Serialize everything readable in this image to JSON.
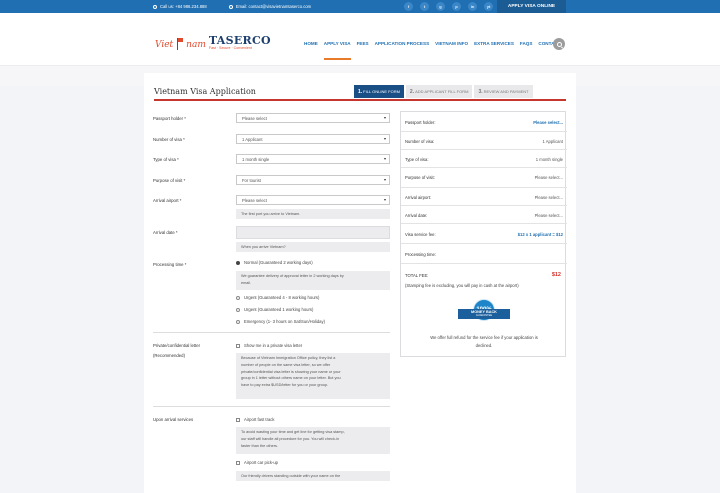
{
  "topbar": {
    "phone": "Call us: +84 986.234.888",
    "email": "Email: contact@visavietnamtaserco.com",
    "socials": [
      "f",
      "t",
      "g",
      "p",
      "in",
      "yt",
      "ig"
    ],
    "apply_label": "APPLY VISA ONLINE"
  },
  "logo": {
    "viet": "Viet",
    "nam": "nam",
    "brand": "TASERCO",
    "tagline": "Fast · Secure · Convenient"
  },
  "nav": [
    "HOME",
    "APPLY VISA",
    "FEES",
    "APPLICATION PROCESS",
    "VIETNAM INFO",
    "EXTRA SERVICES",
    "FAQS",
    "CONTACT"
  ],
  "form": {
    "title": "Vietnam Visa Application",
    "steps": [
      {
        "num": "1.",
        "label": "FILL ONLINE FORM"
      },
      {
        "num": "2.",
        "label": "ADD APPLICANT FILL FORM"
      },
      {
        "num": "3.",
        "label": "REVIEW AND PAYMENT"
      }
    ],
    "passport_holder": {
      "label": "Passport holder *",
      "value": "Please select"
    },
    "number_of_visa": {
      "label": "Number of visa *",
      "value": "1 Applicant"
    },
    "type_of_visa": {
      "label": "Type of visa *",
      "value": "1 month single"
    },
    "purpose_of_visit": {
      "label": "Purpose of visit *",
      "value": "For tourist"
    },
    "arrival_airport": {
      "label": "Arrival airport *",
      "value": "Please select",
      "hint": "The first port you arrive to Vietnam."
    },
    "arrival_date": {
      "label": "Arrival date *",
      "value": "",
      "hint": "When you arrive Vietnam?"
    },
    "processing_time": {
      "label": "Processing time *",
      "options": [
        "Normal (Guaranteed 2 working days)",
        "Urgent (Guaranteed 4 - 8 working hours)",
        "Urgent (Guaranteed 1 working hours)",
        "Emergency (1- 3 hours on Sat/Sun/Holiday)"
      ],
      "selected": 0,
      "note_l1": "We guarantee delivery of approval letter in 2 working days by",
      "note_l2": "email."
    },
    "private_letter": {
      "label": "Private/confidential letter",
      "sublabel": "(Recommended)",
      "option": "Show me in a private visa letter",
      "note": [
        "Because of Vietnam Immigration Office policy, they list a",
        "number of people on the same visa letter, so we offer",
        "private/confidential visa letter is showing your name or your",
        "group in 1 letter without others name on your letter. But you",
        "have to pay extra $USD/letter for you or your group."
      ]
    },
    "upon_arrival": {
      "label": "Upon arrival services",
      "fast_track": "Airport fast track",
      "fast_track_note": [
        "To avoid wasting your time and get line for getting visa stamp,",
        "our staff will handle all procedure for you. You will check-in",
        "faster than the others."
      ],
      "pickup": "Airport car pick-up",
      "pickup_note": "Our friendly drivers standing outside with your name on the"
    }
  },
  "summary": {
    "rows": [
      {
        "k": "Passport holder:",
        "v": "Please select..."
      },
      {
        "k": "Number of visa:",
        "v": "1 Applicant"
      },
      {
        "k": "Type of visa:",
        "v": "1 month single"
      },
      {
        "k": "Purpose of visit:",
        "v": "Please select..."
      },
      {
        "k": "Arrival airport:",
        "v": "Please select..."
      },
      {
        "k": "Arrival date:",
        "v": "Please select..."
      },
      {
        "k": "Visa service fee:",
        "v": "$12 x 1 applicant = $12"
      },
      {
        "k": "Processing time:",
        "v": ""
      }
    ],
    "total_label": "TOTAL FEE:",
    "total_value": "$12",
    "stamp_note": "(Stamping fee is excluding, you will pay in cash at the airport)",
    "badge_top": "100%",
    "badge_line1": "MONEY BACK",
    "badge_line2": "GUARANTEE",
    "refund_l1": "We offer full refund for the service fee if your application is",
    "refund_l2": "declined."
  },
  "colors": {
    "primary": "#1f6fb2",
    "accent": "#c6362e",
    "dark_blue": "#1a4f86"
  }
}
